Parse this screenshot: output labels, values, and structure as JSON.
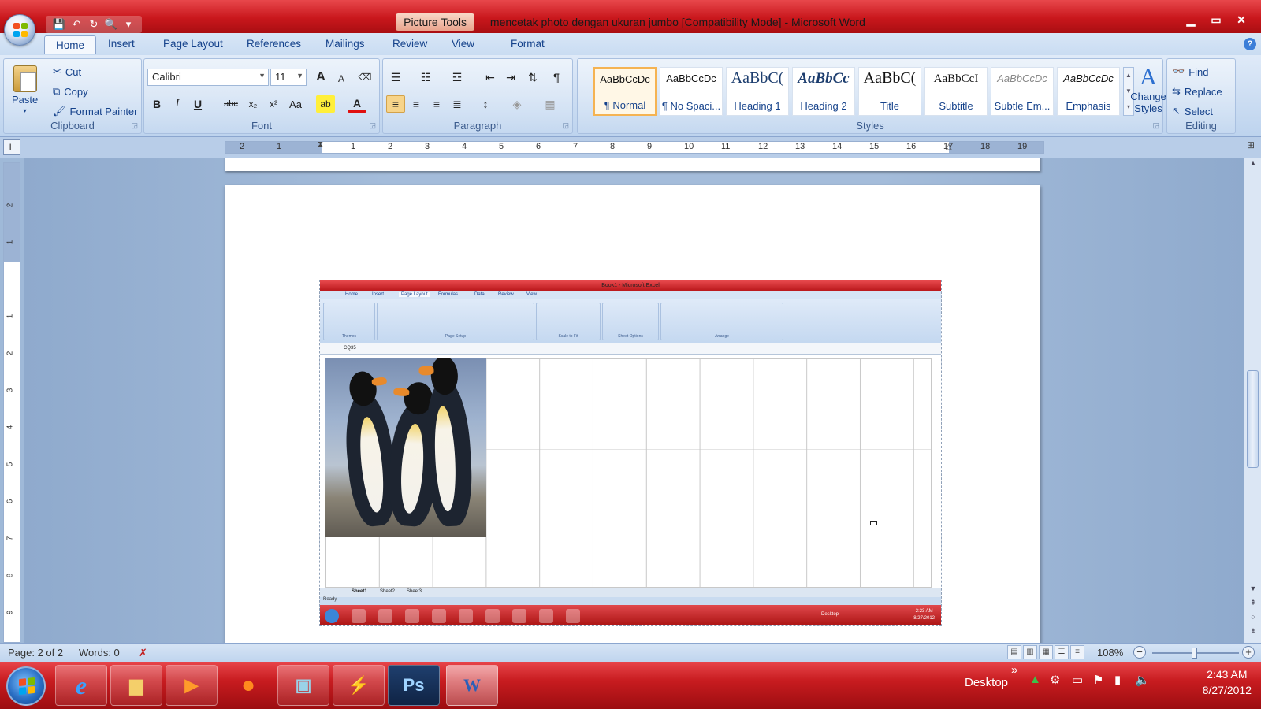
{
  "window": {
    "context_tab": "Picture Tools",
    "title": "mencetak photo dengan ukuran jumbo [Compatibility Mode] - Microsoft Word"
  },
  "quick_access": {
    "icons": [
      "save-icon",
      "undo-icon",
      "redo-icon",
      "print-preview-icon",
      "customize-icon"
    ]
  },
  "window_controls": {
    "minimize": "▁",
    "maximize": "▭",
    "close": "✕"
  },
  "tabs": {
    "home": "Home",
    "insert": "Insert",
    "page_layout": "Page Layout",
    "references": "References",
    "mailings": "Mailings",
    "review": "Review",
    "view": "View",
    "format": "Format",
    "help": "?"
  },
  "clipboard": {
    "paste": "Paste",
    "cut": "Cut",
    "copy": "Copy",
    "format_painter": "Format Painter",
    "title": "Clipboard"
  },
  "font": {
    "name": "Calibri",
    "size": "11",
    "title": "Font",
    "grow": "A",
    "shrink": "A",
    "bold": "B",
    "italic": "I",
    "underline": "U",
    "strike": "abc",
    "subscript": "x₂",
    "superscript": "x²",
    "change_case": "Aa",
    "highlight": "ab",
    "color": "A"
  },
  "paragraph": {
    "title": "Paragraph",
    "show_marks": "¶"
  },
  "styles": {
    "title": "Styles",
    "items": [
      {
        "sample": "AaBbCcDc",
        "label": "¶ Normal"
      },
      {
        "sample": "AaBbCcDc",
        "label": "¶ No Spaci..."
      },
      {
        "sample": "AaBbC(",
        "label": "Heading 1"
      },
      {
        "sample": "AaBbCc",
        "label": "Heading 2"
      },
      {
        "sample": "AaBbC(",
        "label": "Title"
      },
      {
        "sample": "AaBbCcI",
        "label": "Subtitle"
      },
      {
        "sample": "AaBbCcDc",
        "label": "Subtle Em..."
      },
      {
        "sample": "AaBbCcDc",
        "label": "Emphasis"
      }
    ],
    "change_styles_line1": "Change",
    "change_styles_line2": "Styles"
  },
  "editing": {
    "title": "Editing",
    "find": "Find",
    "replace": "Replace",
    "select": "Select"
  },
  "ruler": {
    "tab_selector": "L",
    "h_numbers": [
      "2",
      "1",
      "",
      "1",
      "2",
      "3",
      "4",
      "5",
      "6",
      "7",
      "8",
      "9",
      "10",
      "11",
      "12",
      "13",
      "14",
      "15",
      "16",
      "17",
      "18",
      "19"
    ],
    "v_numbers": [
      "2",
      "1",
      "",
      "1",
      "2",
      "3",
      "4",
      "5",
      "6",
      "7",
      "8",
      "9"
    ]
  },
  "excel_screenshot": {
    "title": "Book1 - Microsoft Excel",
    "tabs": [
      "Home",
      "Insert",
      "Page Layout",
      "Formulas",
      "Data",
      "Review",
      "View"
    ],
    "groups": [
      "Themes",
      "Page Setup",
      "Scale to Fit",
      "Sheet Options",
      "Arrange"
    ],
    "name_box": "CQ35",
    "sheets": [
      "Sheet1",
      "Sheet2",
      "Sheet3"
    ],
    "status": "Ready",
    "tray_label": "Desktop",
    "clock_time": "2:23 AM",
    "clock_date": "8/27/2012"
  },
  "statusbar": {
    "page": "Page: 2 of 2",
    "words": "Words: 0",
    "zoom": "108%"
  },
  "taskbar": {
    "apps": [
      "ie-icon",
      "explorer-icon",
      "media-player-icon",
      "firefox-icon",
      "network-icon",
      "winrar-icon",
      "photoshop-icon",
      "word-icon"
    ],
    "ps_label": "Ps",
    "word_label": "W",
    "desktop": "Desktop",
    "chevron": "»",
    "time": "2:43 AM",
    "date": "8/27/2012"
  }
}
